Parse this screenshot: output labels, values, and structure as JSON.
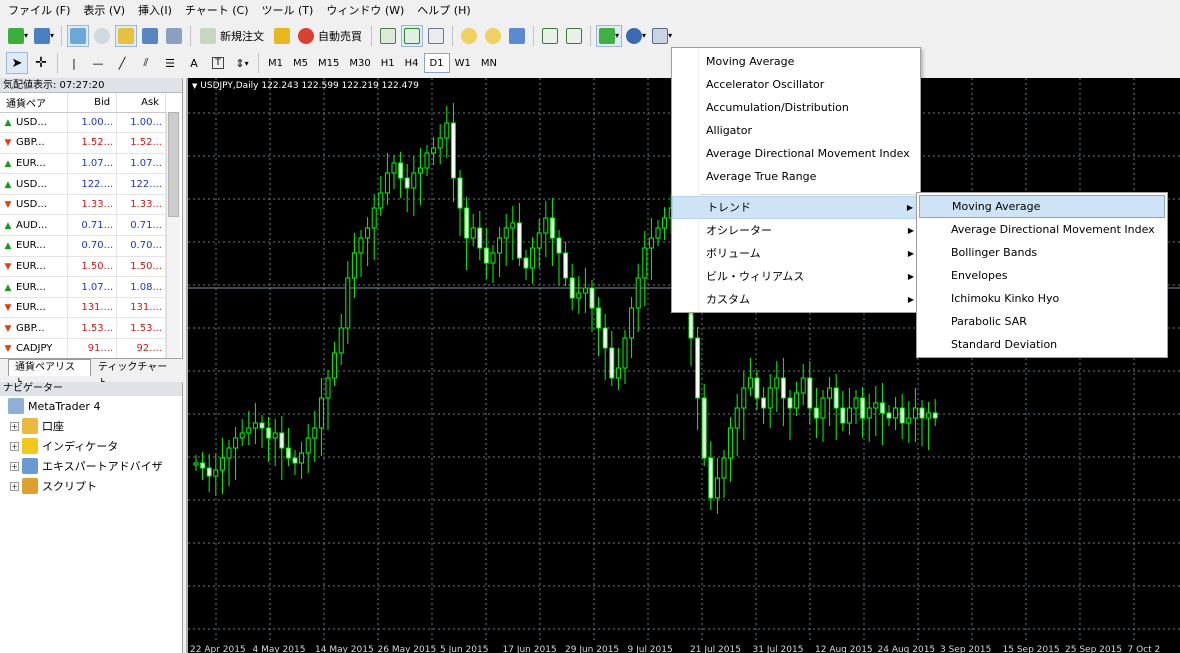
{
  "menubar": [
    "ファイル (F)",
    "表示 (V)",
    "挿入(I)",
    "チャート (C)",
    "ツール (T)",
    "ウィンドウ (W)",
    "ヘルプ (H)"
  ],
  "toolbar": {
    "new_order": "新規注文",
    "auto_trading": "自動売買",
    "timeframes": [
      "M1",
      "M5",
      "M15",
      "M30",
      "H1",
      "H4",
      "D1",
      "W1",
      "MN"
    ],
    "selected_timeframe": "D1",
    "text_tool": "A"
  },
  "market_watch": {
    "title": "気配値表示: 07:27:20",
    "headers": {
      "symbol": "通貨ペア",
      "bid": "Bid",
      "ask": "Ask"
    },
    "rows": [
      {
        "symbol": "USD...",
        "dir": "up",
        "bid": "1.00...",
        "ask": "1.00...",
        "color": "blue"
      },
      {
        "symbol": "GBP...",
        "dir": "down",
        "bid": "1.52...",
        "ask": "1.52...",
        "color": "red"
      },
      {
        "symbol": "EUR...",
        "dir": "up",
        "bid": "1.07...",
        "ask": "1.07...",
        "color": "blue"
      },
      {
        "symbol": "USD...",
        "dir": "up",
        "bid": "122....",
        "ask": "122....",
        "color": "blue"
      },
      {
        "symbol": "USD...",
        "dir": "down",
        "bid": "1.33...",
        "ask": "1.33...",
        "color": "red"
      },
      {
        "symbol": "AUD...",
        "dir": "up",
        "bid": "0.71...",
        "ask": "0.71...",
        "color": "blue"
      },
      {
        "symbol": "EUR...",
        "dir": "up",
        "bid": "0.70...",
        "ask": "0.70...",
        "color": "blue"
      },
      {
        "symbol": "EUR...",
        "dir": "down",
        "bid": "1.50...",
        "ask": "1.50...",
        "color": "red"
      },
      {
        "symbol": "EUR...",
        "dir": "up",
        "bid": "1.07...",
        "ask": "1.08...",
        "color": "blue"
      },
      {
        "symbol": "EUR...",
        "dir": "down",
        "bid": "131....",
        "ask": "131....",
        "color": "red"
      },
      {
        "symbol": "GBP...",
        "dir": "down",
        "bid": "1.53...",
        "ask": "1.53...",
        "color": "red"
      },
      {
        "symbol": "CADJPY",
        "dir": "down",
        "bid": "91....",
        "ask": "92....",
        "color": "red"
      }
    ],
    "tabs": [
      "通貨ペアリスト",
      "ティックチャート"
    ]
  },
  "navigator": {
    "title": "ナビゲーター",
    "root": "MetaTrader 4",
    "items": [
      {
        "label": "口座",
        "icon": "accounts-icon"
      },
      {
        "label": "インディケータ",
        "icon": "indicators-icon"
      },
      {
        "label": "エキスパートアドバイザ",
        "icon": "expert-advisors-icon"
      },
      {
        "label": "スクリプト",
        "icon": "scripts-icon"
      }
    ]
  },
  "chart": {
    "header": "USDJPY,Daily  122.243 122.599 122.219 122.479",
    "x_labels": [
      "22 Apr 2015",
      "4 May 2015",
      "14 May 2015",
      "26 May 2015",
      "5 Jun 2015",
      "17 Jun 2015",
      "29 Jun 2015",
      "9 Jul 2015",
      "21 Jul 2015",
      "31 Jul 2015",
      "12 Aug 2015",
      "24 Aug 2015",
      "3 Sep 2015",
      "15 Sep 2015",
      "25 Sep 2015",
      "7 Oct 2"
    ],
    "colors": {
      "background": "#000000",
      "bull": "#00ff00",
      "grid": "#6a7a8a",
      "bid_line": "#7f90a8"
    }
  },
  "insert_menu": {
    "items": [
      "Moving Average",
      "Accelerator Oscillator",
      "Accumulation/Distribution",
      "Alligator",
      "Average Directional Movement Index",
      "Average True Range"
    ],
    "submenus": [
      "トレンド",
      "オシレーター",
      "ボリューム",
      "ビル・ウィリアムス",
      "カスタム"
    ],
    "highlighted_submenu": "トレンド"
  },
  "trend_submenu": {
    "items": [
      "Moving Average",
      "Average Directional Movement Index",
      "Bollinger Bands",
      "Envelopes",
      "Ichimoku Kinko Hyo",
      "Parabolic SAR",
      "Standard Deviation"
    ],
    "highlighted": "Moving Average"
  }
}
